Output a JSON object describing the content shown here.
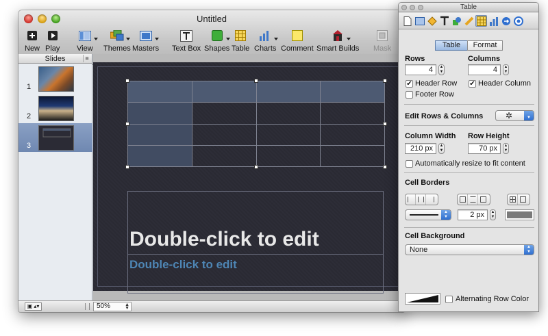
{
  "window": {
    "title": "Untitled"
  },
  "toolbar": {
    "items": [
      {
        "label": "New",
        "icon": "new-slide-icon"
      },
      {
        "label": "Play",
        "icon": "play-icon"
      },
      {
        "label": "View",
        "icon": "view-icon"
      },
      {
        "label": "Themes",
        "icon": "themes-icon"
      },
      {
        "label": "Masters",
        "icon": "masters-icon"
      },
      {
        "label": "Text Box",
        "icon": "text-box-icon"
      },
      {
        "label": "Shapes",
        "icon": "shapes-icon"
      },
      {
        "label": "Table",
        "icon": "table-icon"
      },
      {
        "label": "Charts",
        "icon": "charts-icon"
      },
      {
        "label": "Comment",
        "icon": "comment-icon"
      },
      {
        "label": "Smart Builds",
        "icon": "smart-builds-icon"
      },
      {
        "label": "Mask",
        "icon": "mask-icon"
      }
    ]
  },
  "navigator": {
    "header": "Slides",
    "slides": [
      {
        "number": "1"
      },
      {
        "number": "2"
      },
      {
        "number": "3",
        "selected": true
      }
    ]
  },
  "slide": {
    "title_placeholder": "Double-click to edit",
    "subtitle_placeholder": "Double-click to edit",
    "table": {
      "rows": 4,
      "columns": 4
    }
  },
  "bottom_bar": {
    "zoom": "50%"
  },
  "inspector": {
    "title": "Table",
    "tabs": {
      "table": "Table",
      "format": "Format"
    },
    "rows_label": "Rows",
    "rows_value": "4",
    "columns_label": "Columns",
    "columns_value": "4",
    "header_row": "Header Row",
    "header_column": "Header Column",
    "footer_row": "Footer Row",
    "edit_rows_columns": "Edit Rows & Columns",
    "column_width_label": "Column Width",
    "column_width_value": "210 px",
    "row_height_label": "Row Height",
    "row_height_value": "70 px",
    "auto_resize": "Automatically resize to fit content",
    "cell_borders": "Cell Borders",
    "border_width": "2 px",
    "cell_background": "Cell Background",
    "background_value": "None",
    "alternating_row_color": "Alternating Row Color"
  },
  "colors": {
    "accent": "#4e86b5",
    "slide_background": "#2b2b35",
    "table_header": "#4d5a72"
  }
}
